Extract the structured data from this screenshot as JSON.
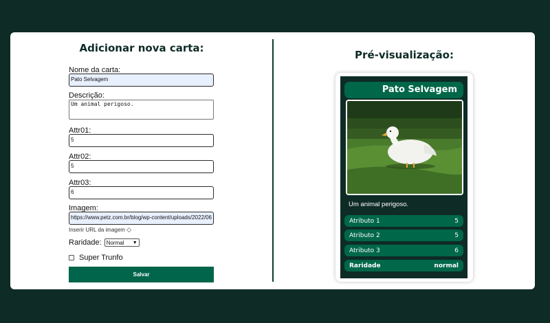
{
  "form": {
    "title": "Adicionar nova carta:",
    "name_label": "Nome da carta:",
    "name_value": "Pato Selvagem",
    "description_label": "Descrição:",
    "description_value": "Um animal perigoso.",
    "attr1_label": "Attr01:",
    "attr1_value": "5",
    "attr2_label": "Attr02:",
    "attr2_value": "5",
    "attr3_label": "Attr03:",
    "attr3_value": "6",
    "image_label": "Imagem:",
    "image_value": "https://www.petz.com.br/blog/wp-content/uploads/2022/06",
    "image_hint": "Inserir URL da imagem",
    "image_hint_icon": "◇",
    "rarity_label": "Raridade:",
    "rarity_value": "Normal",
    "super_trunfo_label": "Super Trunfo",
    "super_trunfo_checked": false,
    "save_label": "Salvar"
  },
  "preview": {
    "title": "Pré-visualização:",
    "card": {
      "name": "Pato Selvagem",
      "description": "Um animal perigoso.",
      "attributes": [
        {
          "label": "Atributo 1",
          "value": "5"
        },
        {
          "label": "Atributo 2",
          "value": "5"
        },
        {
          "label": "Atributo 3",
          "value": "6"
        }
      ],
      "rarity_label": "Raridade",
      "rarity_value": "normal",
      "image_subject": "white duck on grass"
    }
  },
  "colors": {
    "background": "#0e2b26",
    "accent": "#006749",
    "panel": "#ffffff"
  }
}
